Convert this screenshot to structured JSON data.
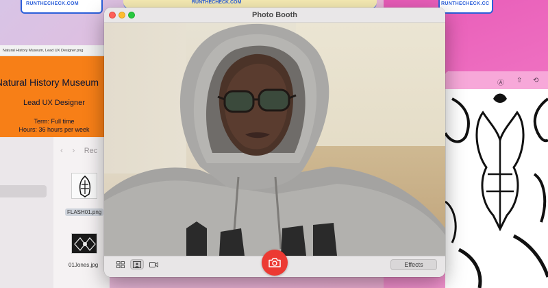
{
  "background": {
    "top_left_caption": "RUNTHECHECK.COM",
    "top_mid_caption": "RUNTHECHECK.COM",
    "top_right_caption": "RUNTHECHECK.CC"
  },
  "preview": {
    "title": "Natural History Museum, Lead UX Designer.png",
    "poster": {
      "title": "Natural History Museum",
      "role": "Lead UX Designer",
      "term": "Term: Full time",
      "hours": "Hours: 36 hours per week"
    }
  },
  "finder": {
    "nav_back": "‹",
    "nav_forward": "›",
    "location": "Rec",
    "files": [
      {
        "name": "FLASH01.png",
        "selected": true
      },
      {
        "name": "01Jones.jpg",
        "selected": false
      }
    ]
  },
  "photo_booth": {
    "title": "Photo Booth",
    "effects_label": "Effects",
    "view_modes": [
      "grid-view-icon",
      "single-photo-icon",
      "video-icon"
    ],
    "active_view": "single-photo-icon"
  },
  "colors": {
    "shutter": "#ec3a33",
    "poster_bg": "#f77f17",
    "accent_blue": "#2b5fd9",
    "pink_bg": "#e85bb8"
  }
}
